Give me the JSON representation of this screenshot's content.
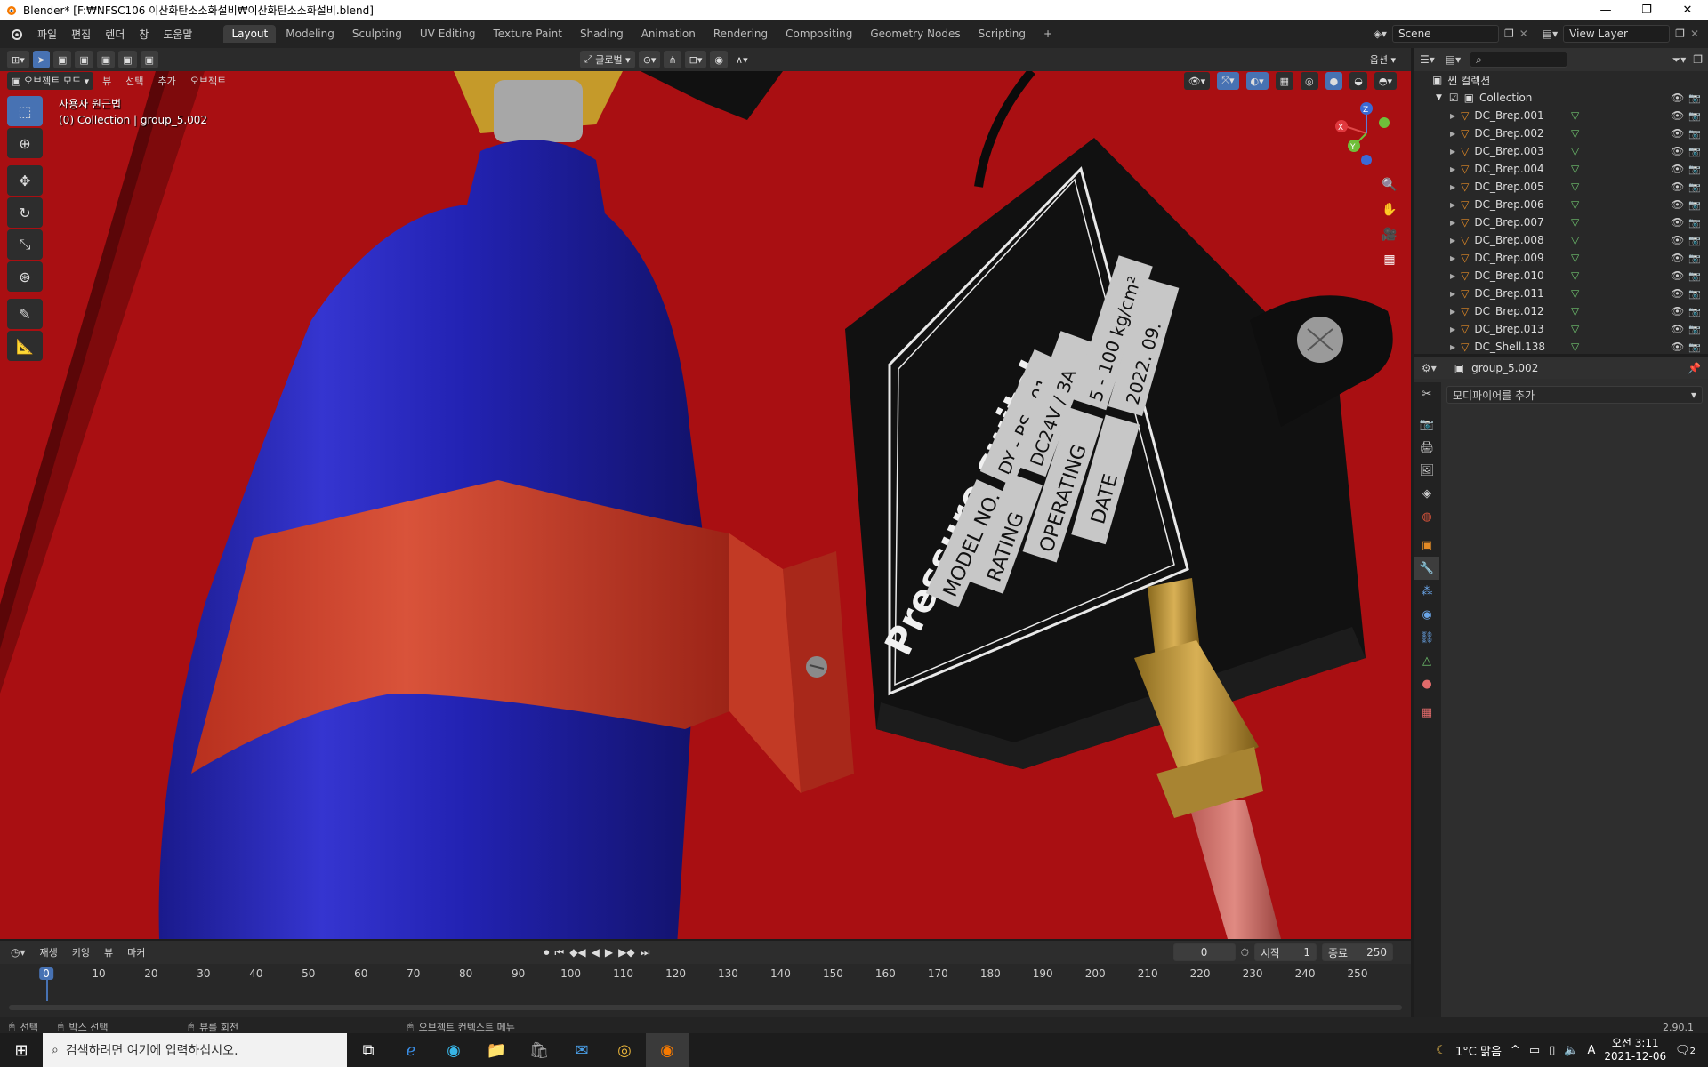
{
  "window": {
    "title": "Blender* [F:₩NFSC106 이산화탄소소화설비₩이산화탄소소화설비.blend]",
    "controls": [
      "—",
      "❐",
      "✕"
    ]
  },
  "topbar": {
    "menus": [
      "파일",
      "편집",
      "렌더",
      "창",
      "도움말"
    ],
    "workspaces": [
      "Layout",
      "Modeling",
      "Sculpting",
      "UV Editing",
      "Texture Paint",
      "Shading",
      "Animation",
      "Rendering",
      "Compositing",
      "Geometry Nodes",
      "Scripting"
    ],
    "active_workspace": "Layout",
    "add_tab": "+",
    "scene": "Scene",
    "view_layer": "View Layer"
  },
  "viewport_header": {
    "transform_orientation": "글로벌",
    "options": "옵션",
    "mode": "오브젝트 모드",
    "menus": [
      "뷰",
      "선택",
      "추가",
      "오브젝트"
    ]
  },
  "viewport": {
    "view_name": "사용자 원근법",
    "collection_info": "(0) Collection | group_5.002",
    "label": {
      "title": "Pressure switch",
      "rows": [
        {
          "key": "MODEL NO.",
          "value": "DY - PS - 01"
        },
        {
          "key": "RATING",
          "value": "DC24V / 3A"
        },
        {
          "key": "OPERATING",
          "value": "5 - 100 kg/cm²"
        },
        {
          "key": "DATE",
          "value": "2022. 09."
        }
      ]
    },
    "gizmo": {
      "x": "X",
      "y": "Y",
      "z": "Z"
    }
  },
  "outliner": {
    "root": "씬 컬렉션",
    "collection": "Collection",
    "items": [
      "DC_Brep.001",
      "DC_Brep.002",
      "DC_Brep.003",
      "DC_Brep.004",
      "DC_Brep.005",
      "DC_Brep.006",
      "DC_Brep.007",
      "DC_Brep.008",
      "DC_Brep.009",
      "DC_Brep.010",
      "DC_Brep.011",
      "DC_Brep.012",
      "DC_Brep.013",
      "DC_Shell.138"
    ]
  },
  "properties": {
    "object_name": "group_5.002",
    "add_modifier": "모디파이어를 추가"
  },
  "timeline": {
    "menus": [
      "재생",
      "키잉",
      "뷰",
      "마커"
    ],
    "current_frame": "0",
    "start_label": "시작",
    "start": "1",
    "end_label": "종료",
    "end": "250",
    "ticks": [
      "0",
      "10",
      "20",
      "30",
      "40",
      "50",
      "60",
      "70",
      "80",
      "90",
      "100",
      "110",
      "120",
      "130",
      "140",
      "150",
      "160",
      "170",
      "180",
      "190",
      "200",
      "210",
      "220",
      "230",
      "240",
      "250"
    ]
  },
  "statusbar": {
    "select": "선택",
    "box_select": "박스 선택",
    "rotate_view": "뷰를 회전",
    "context_menu": "오브젝트 컨텍스트 메뉴",
    "version": "2.90.1"
  },
  "taskbar": {
    "search_placeholder": "검색하려면 여기에 입력하십시오.",
    "weather": "1°C 맑음",
    "time": "오전 3:11",
    "date": "2021-12-06",
    "notifications": "2"
  }
}
